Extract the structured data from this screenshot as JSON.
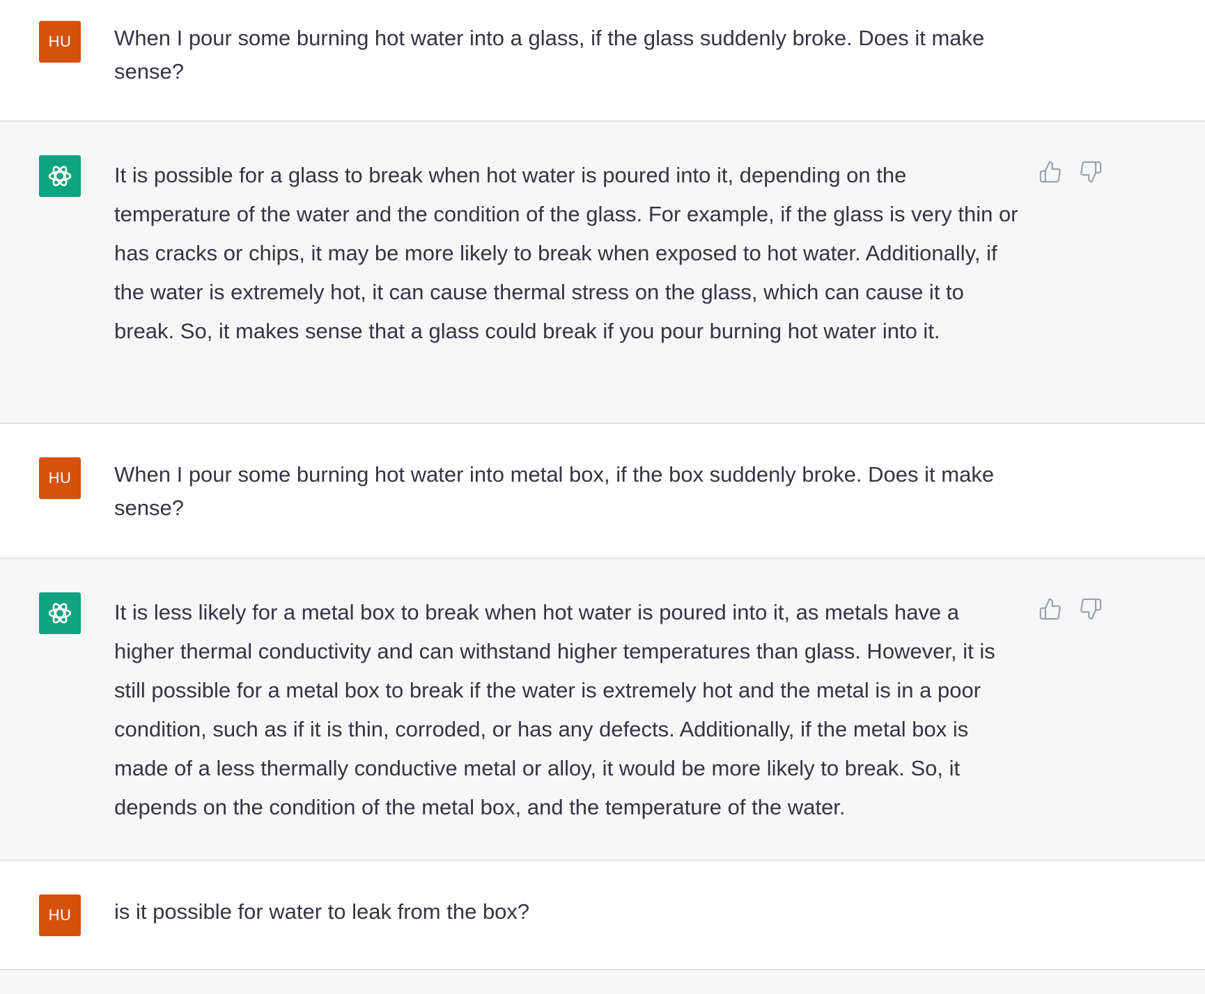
{
  "messages": [
    {
      "role": "user",
      "avatar_label": "HU",
      "text": "When I pour some burning hot water into a glass, if the glass suddenly broke. Does it make sense?"
    },
    {
      "role": "assistant",
      "avatar_icon": "openai-logo-icon",
      "text": "It is possible for a glass to break when hot water is poured into it, depending on the temperature of the water and the condition of the glass. For example, if the glass is very thin or has cracks or chips, it may be more likely to break when exposed to hot water. Additionally, if the water is extremely hot, it can cause thermal stress on the glass, which can cause it to break. So, it makes sense that a glass could break if you pour burning hot water into it."
    },
    {
      "role": "user",
      "avatar_label": "HU",
      "text": "When I pour some burning hot water into metal box, if the box suddenly broke. Does it make sense?"
    },
    {
      "role": "assistant",
      "avatar_icon": "openai-logo-icon",
      "text": "It is less likely for a metal box to break when hot water is poured into it, as metals have a higher thermal conductivity and can withstand higher temperatures than glass. However, it is still possible for a metal box to break if the water is extremely hot and the metal is in a poor condition, such as if it is thin, corroded, or has any defects. Additionally, if the metal box is made of a less thermally conductive metal or alloy, it would be more likely to break. So, it depends on the condition of the metal box, and the temperature of the water."
    },
    {
      "role": "user",
      "avatar_label": "HU",
      "text": "is it possible for water to leak from the box?"
    }
  ],
  "icons": {
    "thumbs_up": "thumbs-up-icon",
    "thumbs_down": "thumbs-down-icon"
  },
  "colors": {
    "user_avatar_bg": "#d6510b",
    "assistant_avatar_bg": "#10a37f",
    "assistant_row_bg": "#f7f7f8",
    "user_row_bg": "#ffffff",
    "text": "#343541",
    "divider": "#e2e3e7"
  }
}
